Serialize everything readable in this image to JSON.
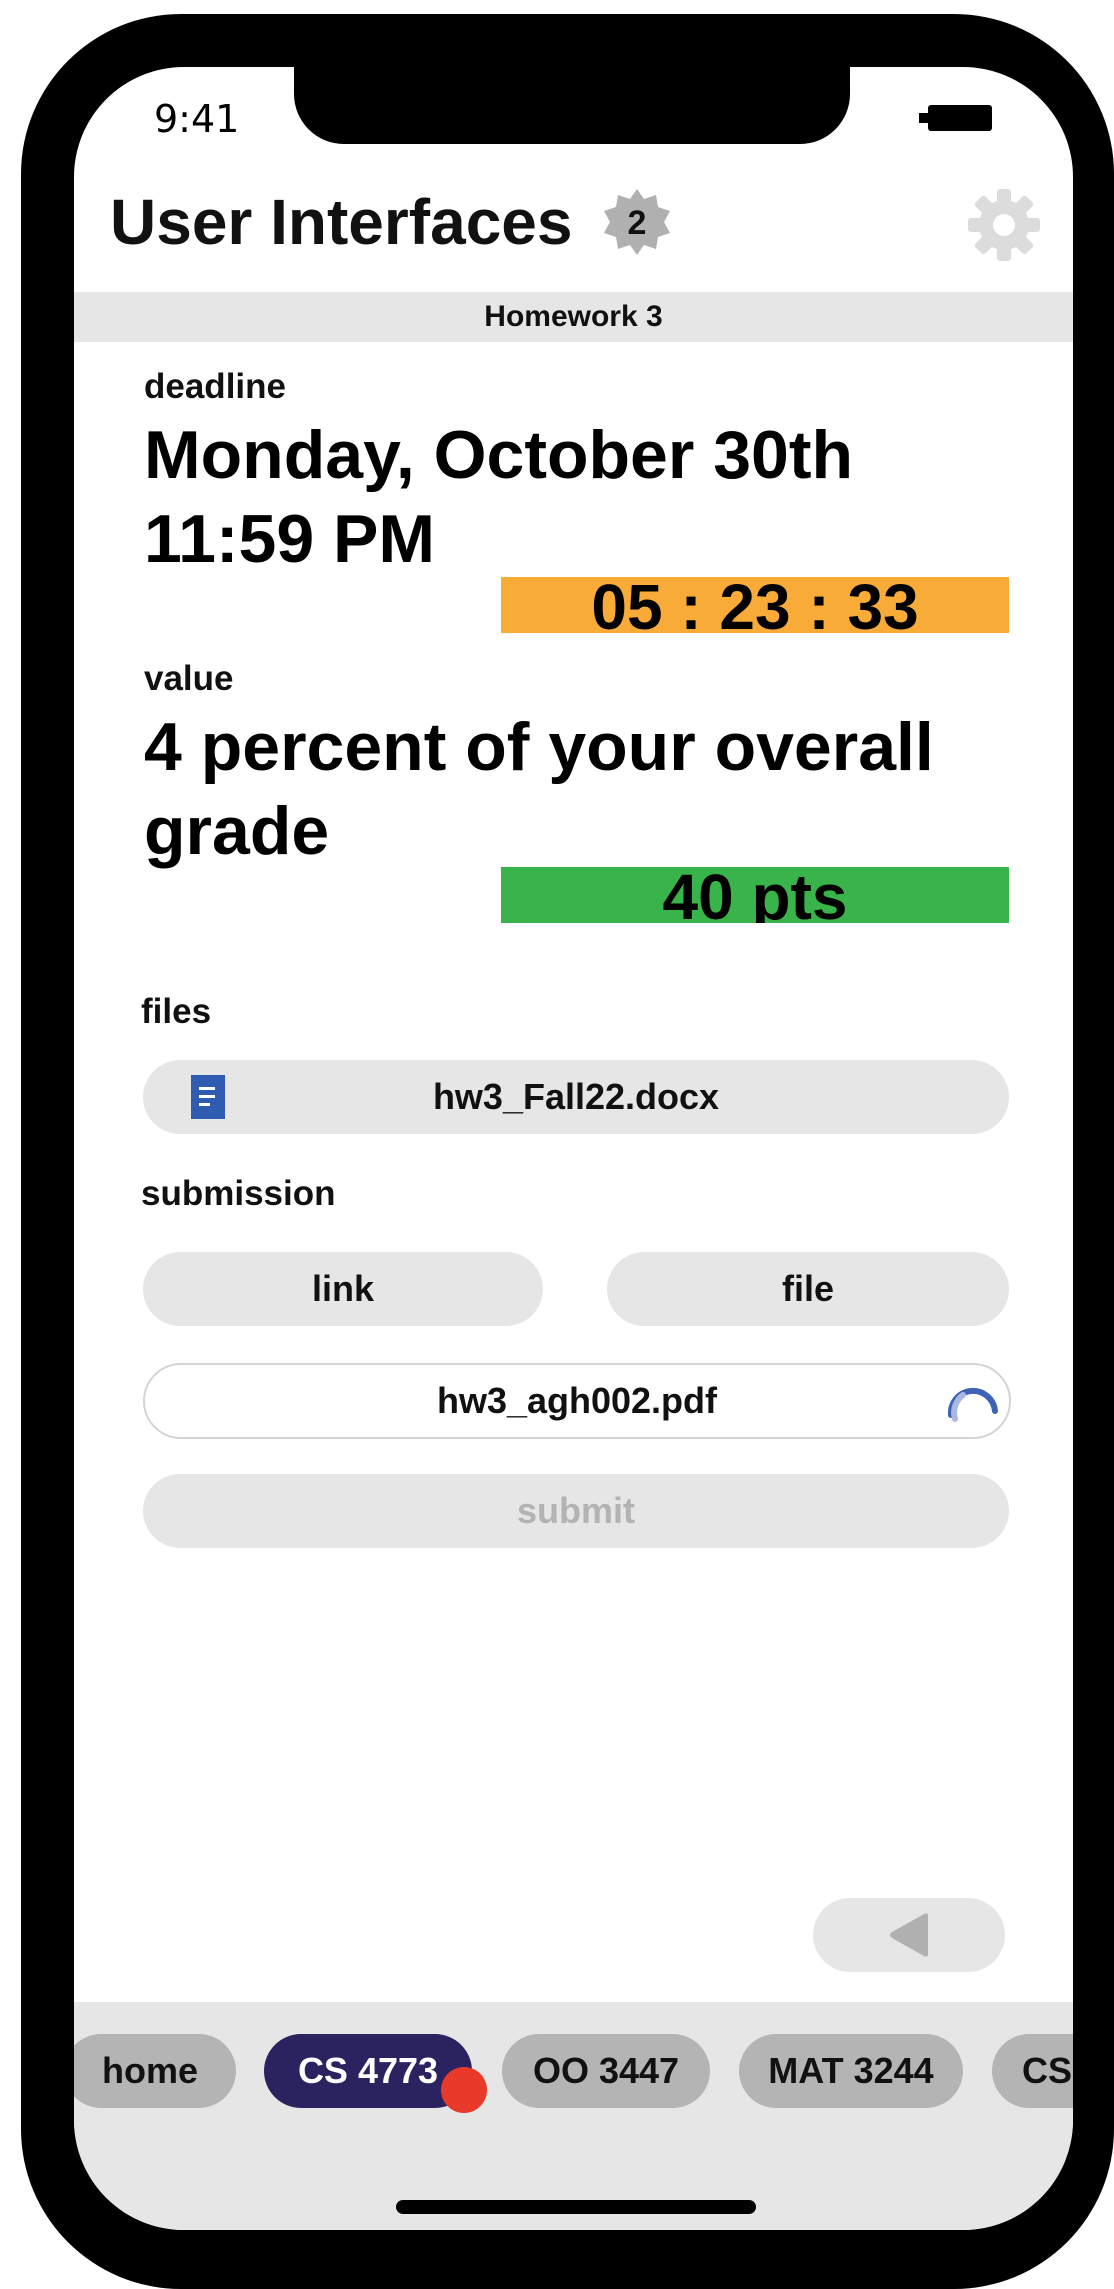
{
  "status": {
    "time": "9:41"
  },
  "header": {
    "title": "User Interfaces",
    "badge_count": "2",
    "settings_icon": "gear-icon",
    "badge_icon": "seal-badge-icon"
  },
  "subheader": {
    "title": "Homework 3"
  },
  "deadline": {
    "label": "deadline",
    "line1": "Monday, October 30th",
    "line2": "11:59 PM",
    "countdown": "05 : 23 : 33",
    "countdown_color": "#f9ab38"
  },
  "value": {
    "label": "value",
    "line1": "4 percent of your overall",
    "line2": "grade",
    "points": "40 pts",
    "points_color": "#38b44a"
  },
  "files": {
    "label": "files",
    "items": [
      {
        "name": "hw3_Fall22.docx",
        "icon": "document-icon"
      }
    ]
  },
  "submission": {
    "label": "submission",
    "link_label": "link",
    "file_label": "file",
    "selected_file": "hw3_agh002.pdf",
    "submit_label": "submit",
    "status_icon": "loading-spinner-icon"
  },
  "navigation": {
    "back_icon": "back-arrow-icon"
  },
  "tabs": [
    {
      "label": "home",
      "active": false
    },
    {
      "label": "CS 4773",
      "active": true,
      "has_notification": true
    },
    {
      "label": "OO 3447",
      "active": false
    },
    {
      "label": "MAT 3244",
      "active": false
    },
    {
      "label": "CS",
      "active": false
    }
  ],
  "colors": {
    "accent_dark": "#2b2260",
    "notification": "#e8392a",
    "pill_bg": "#e6e6e6"
  }
}
